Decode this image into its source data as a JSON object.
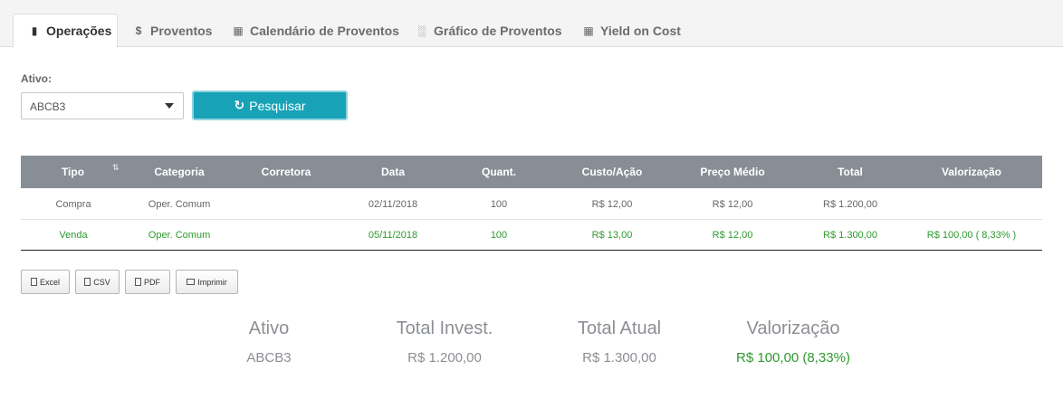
{
  "tabs": [
    {
      "label": "Operações",
      "icon": "book-icon",
      "active": true
    },
    {
      "label": "Proventos",
      "icon": "dollar-icon",
      "active": false
    },
    {
      "label": "Calendário de Proventos",
      "icon": "calendar-icon",
      "active": false
    },
    {
      "label": "Gráfico de Proventos",
      "icon": "bar-chart-icon",
      "active": false
    },
    {
      "label": "Yield on Cost",
      "icon": "calculator-icon",
      "active": false
    }
  ],
  "form": {
    "ativo_label": "Ativo:",
    "ativo_value": "ABCB3",
    "search_label": "Pesquisar"
  },
  "table": {
    "headers": [
      "Tipo",
      "Categoria",
      "Corretora",
      "Data",
      "Quant.",
      "Custo/Ação",
      "Preço Médio",
      "Total",
      "Valorização"
    ],
    "sort_icon": "⇅",
    "rows": [
      {
        "tipo": "Compra",
        "categoria": "Oper. Comum",
        "corretora": "",
        "data": "02/11/2018",
        "quant": "100",
        "custo": "R$ 12,00",
        "preco_medio": "R$ 12,00",
        "total": "R$ 1.200,00",
        "valorizacao": ""
      },
      {
        "tipo": "Venda",
        "categoria": "Oper. Comum",
        "corretora": "",
        "data": "05/11/2018",
        "quant": "100",
        "custo": "R$ 13,00",
        "preco_medio": "R$ 12,00",
        "total": "R$ 1.300,00",
        "valorizacao": "R$ 100,00 ( 8,33% )"
      }
    ]
  },
  "export": {
    "excel": "Excel",
    "csv": "CSV",
    "pdf": "PDF",
    "print": "Imprimir"
  },
  "summary": {
    "ativo_label": "Ativo",
    "ativo_value": "ABCB3",
    "invest_label": "Total Invest.",
    "invest_value": "R$ 1.200,00",
    "atual_label": "Total Atual",
    "atual_value": "R$ 1.300,00",
    "valorizacao_label": "Valorização",
    "valorizacao_value": "R$ 100,00 (8,33%)"
  },
  "colors": {
    "accent": "#17a2b8",
    "table_header": "#878e96",
    "positive": "#2e9a2e"
  }
}
